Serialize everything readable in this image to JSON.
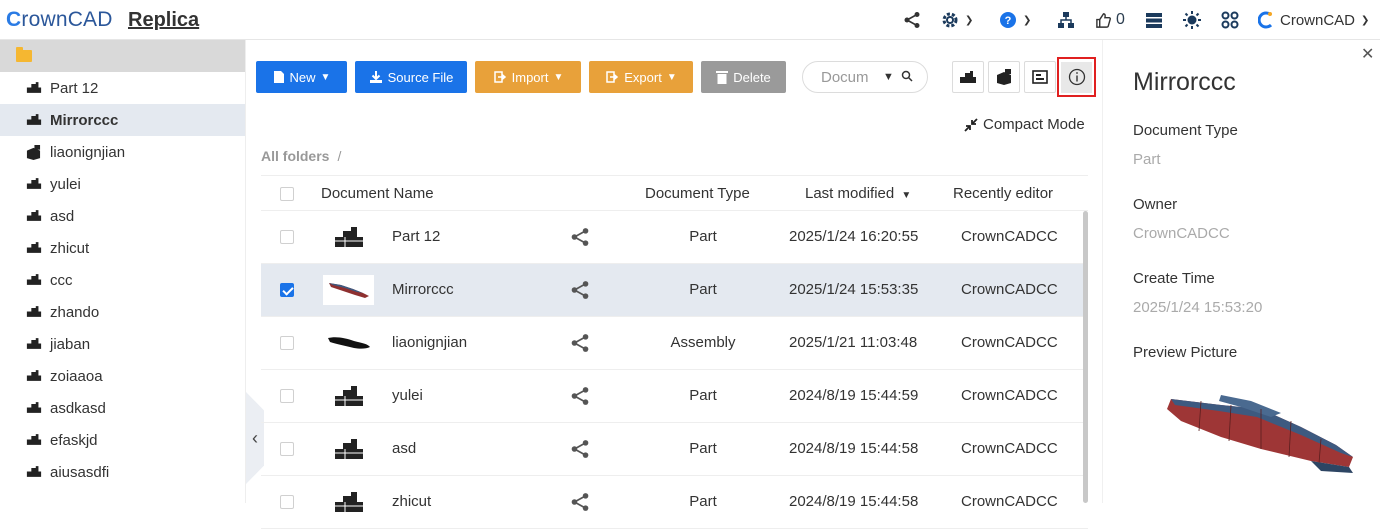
{
  "header": {
    "logo_prefix": "C",
    "logo_rest": "rownCAD",
    "doc_title": "Replica",
    "likes_count": "0",
    "user_name": "CrownCAD"
  },
  "sidebar": {
    "items": [
      {
        "label": "Part 12",
        "icon": "part-icon",
        "active": false
      },
      {
        "label": "Mirrorccc",
        "icon": "part-icon",
        "active": true
      },
      {
        "label": "liaonignjian",
        "icon": "assembly-icon",
        "active": false
      },
      {
        "label": "yulei",
        "icon": "part-icon",
        "active": false
      },
      {
        "label": "asd",
        "icon": "part-icon",
        "active": false
      },
      {
        "label": "zhicut",
        "icon": "part-icon",
        "active": false
      },
      {
        "label": "ccc",
        "icon": "part-icon",
        "active": false
      },
      {
        "label": "zhando",
        "icon": "part-icon",
        "active": false
      },
      {
        "label": "jiaban",
        "icon": "part-icon",
        "active": false
      },
      {
        "label": "zoiaaoa",
        "icon": "part-icon",
        "active": false
      },
      {
        "label": "asdkasd",
        "icon": "part-icon",
        "active": false
      },
      {
        "label": "efaskjd",
        "icon": "part-icon",
        "active": false
      },
      {
        "label": "aiusasdfi",
        "icon": "part-icon",
        "active": false
      }
    ]
  },
  "toolbar": {
    "new_label": "New",
    "source_file_label": "Source File",
    "import_label": "Import",
    "export_label": "Export",
    "delete_label": "Delete",
    "search_placeholder": "Docum",
    "compact_mode_label": "Compact Mode"
  },
  "breadcrumb": {
    "root": "All folders",
    "separator": "/"
  },
  "table": {
    "headers": {
      "name": "Document Name",
      "type": "Document Type",
      "modified": "Last modified",
      "editor": "Recently editor"
    },
    "rows": [
      {
        "name": "Part 12",
        "type": "Part",
        "modified": "2025/1/24 16:20:55",
        "editor": "CrownCADCC",
        "selected": false,
        "thumb": "part"
      },
      {
        "name": "Mirrorccc",
        "type": "Part",
        "modified": "2025/1/24 15:53:35",
        "editor": "CrownCADCC",
        "selected": true,
        "thumb": "model"
      },
      {
        "name": "liaonignjian",
        "type": "Assembly",
        "modified": "2025/1/21 11:03:48",
        "editor": "CrownCADCC",
        "selected": false,
        "thumb": "silhouette"
      },
      {
        "name": "yulei",
        "type": "Part",
        "modified": "2024/8/19 15:44:59",
        "editor": "CrownCADCC",
        "selected": false,
        "thumb": "part"
      },
      {
        "name": "asd",
        "type": "Part",
        "modified": "2024/8/19 15:44:58",
        "editor": "CrownCADCC",
        "selected": false,
        "thumb": "part"
      },
      {
        "name": "zhicut",
        "type": "Part",
        "modified": "2024/8/19 15:44:58",
        "editor": "CrownCADCC",
        "selected": false,
        "thumb": "part"
      }
    ]
  },
  "details": {
    "title": "Mirrorccc",
    "doc_type_label": "Document Type",
    "doc_type_value": "Part",
    "owner_label": "Owner",
    "owner_value": "CrownCADCC",
    "create_time_label": "Create Time",
    "create_time_value": "2025/1/24 15:53:20",
    "preview_label": "Preview Picture"
  },
  "colors": {
    "primary": "#1a73e8",
    "import_export": "#e8a13a",
    "delete": "#9a9a9a",
    "selected_row": "#e4e9f0",
    "highlight_border": "#e02020"
  }
}
